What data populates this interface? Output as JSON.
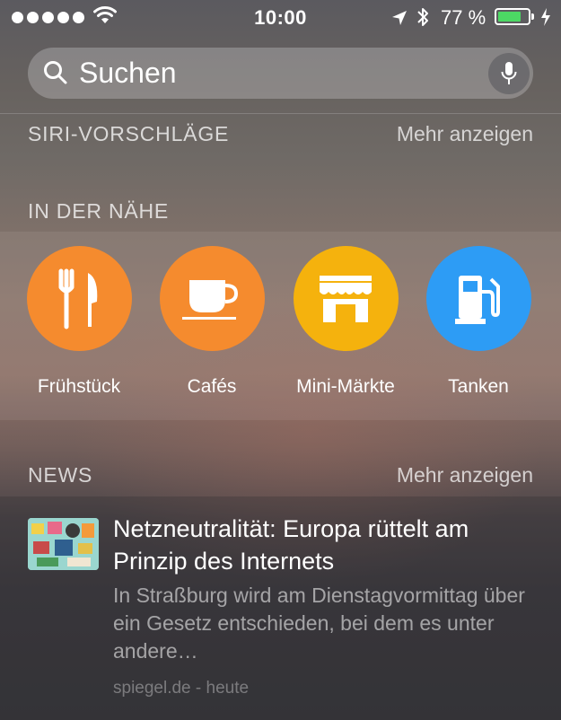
{
  "status_bar": {
    "time": "10:00",
    "battery_percent": "77 %",
    "battery_level": 0.77,
    "signal_dots": 5
  },
  "search": {
    "placeholder": "Suchen"
  },
  "siri": {
    "title": "SIRI-VORSCHLÄGE",
    "more": "Mehr anzeigen"
  },
  "nearby": {
    "title": "IN DER NÄHE",
    "items": [
      {
        "label": "Frühstück",
        "icon": "fork-knife-icon",
        "color": "#f58b2e"
      },
      {
        "label": "Cafés",
        "icon": "coffee-cup-icon",
        "color": "#f58b2e"
      },
      {
        "label": "Mini-Märkte",
        "icon": "store-icon",
        "color": "#f5b20d"
      },
      {
        "label": "Tanken",
        "icon": "gas-pump-icon",
        "color": "#2d9cf5"
      }
    ]
  },
  "news": {
    "title": "NEWS",
    "more": "Mehr anzeigen",
    "article": {
      "headline": "Netzneutralität: Europa rüttelt am Prinzip des Internets",
      "summary": "In Straßburg wird am Dienstagvormittag über ein Gesetz entschieden, bei dem es unter andere…",
      "source": "spiegel.de - heute"
    }
  },
  "colors": {
    "battery_fill": "#4cd964"
  }
}
